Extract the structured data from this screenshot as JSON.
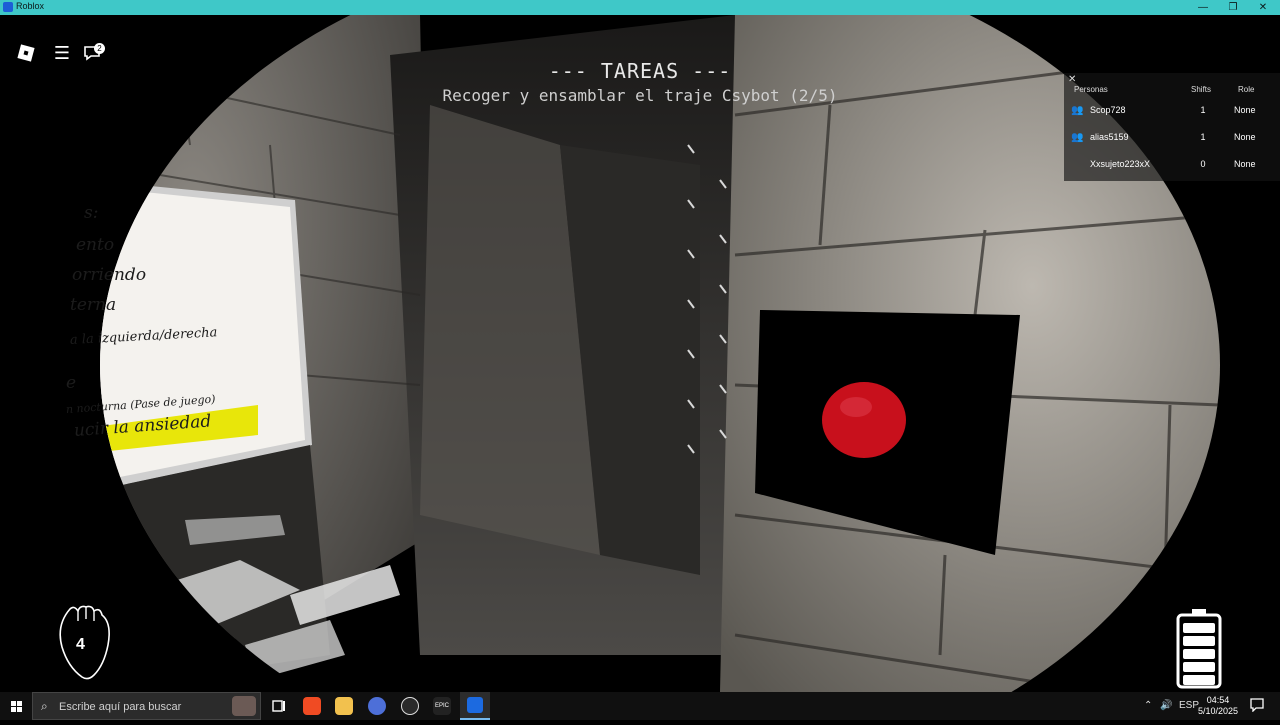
{
  "window": {
    "title": "Roblox",
    "minimize": "—",
    "maximize": "❐",
    "close": "✕"
  },
  "roblox_ui": {
    "chat_badge": "2",
    "menu_icon": "☰",
    "chat_icon": "🗨"
  },
  "tasks": {
    "header": "--- TAREAS ---",
    "current_task": "Recoger y ensamblar el traje Csybot (2/5)"
  },
  "whiteboard": {
    "lines": [
      "s:",
      "ento",
      "orriendo",
      "terna",
      "a la izquierda/derecha",
      "e",
      "n nocturna (Pase de juego)",
      "ucir la ansiedad"
    ]
  },
  "player_list": {
    "close_icon": "✕",
    "headers": {
      "name": "Personas",
      "shifts": "Shifts",
      "role": "Role"
    },
    "players": [
      {
        "name": "Scop728",
        "shifts": "1",
        "role": "None",
        "friend_icon": true
      },
      {
        "name": "alias5159",
        "shifts": "1",
        "role": "None",
        "friend_icon": true
      },
      {
        "name": "Xxsujeto223xX",
        "shifts": "0",
        "role": "None",
        "friend_icon": false
      }
    ]
  },
  "hud": {
    "heart_value": "4",
    "battery_level": 1.0
  },
  "taskbar": {
    "search_placeholder": "Escribe aquí para buscar",
    "language": "ESP",
    "time": "04:54",
    "date": "5/10/2025",
    "epic_label": "EPIC"
  },
  "colors": {
    "titlebar": "#3fc8c8",
    "button_red": "#c8101c",
    "highlight_yellow": "#e8e60a"
  }
}
